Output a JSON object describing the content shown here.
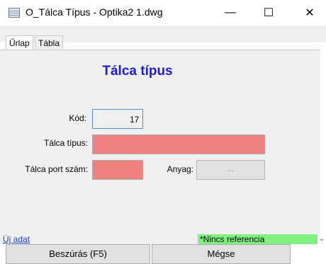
{
  "window": {
    "title": "O_Tálca Típus - Optika2 1.dwg",
    "minimize": "—",
    "maximize": "☐",
    "close": "✕"
  },
  "tabs": [
    {
      "label": "Űrlap",
      "active": true
    },
    {
      "label": "Tábla",
      "active": false
    }
  ],
  "form": {
    "heading": "Tálca típus",
    "kod_label": "Kód:",
    "kod_value": "17",
    "tipus_label": "Tálca típus:",
    "tipus_value": "",
    "port_label": "Tálca port szám:",
    "port_value": "",
    "anyag_label": "Anyag:",
    "anyag_button": "..."
  },
  "status": {
    "left": "Új adat",
    "right": "*Nincs referencia"
  },
  "buttons": {
    "insert": "Beszúrás (F5)",
    "cancel": "Mégse"
  },
  "colors": {
    "heading": "#1d1dd6",
    "required_field": "#f08080",
    "status_ok": "#80f080"
  }
}
